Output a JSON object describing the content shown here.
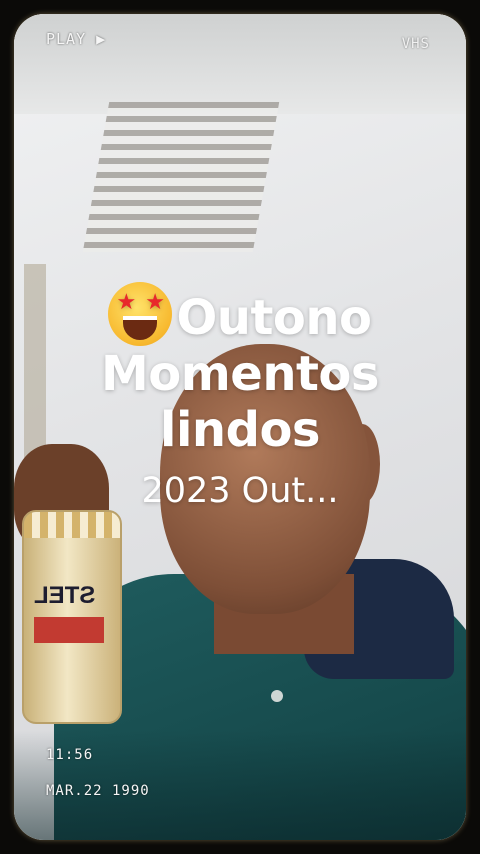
{
  "overlay": {
    "play_label": "PLAY ▶",
    "format_label": "VHS",
    "time": "11:56",
    "date": "MAR.22 1990"
  },
  "title": {
    "emoji": "star-struck-emoji",
    "line1": "Outono",
    "line2": "Momentos",
    "line3": "lindos",
    "subtitle": "2023 Out..."
  },
  "photo": {
    "can_text": "STEL"
  }
}
